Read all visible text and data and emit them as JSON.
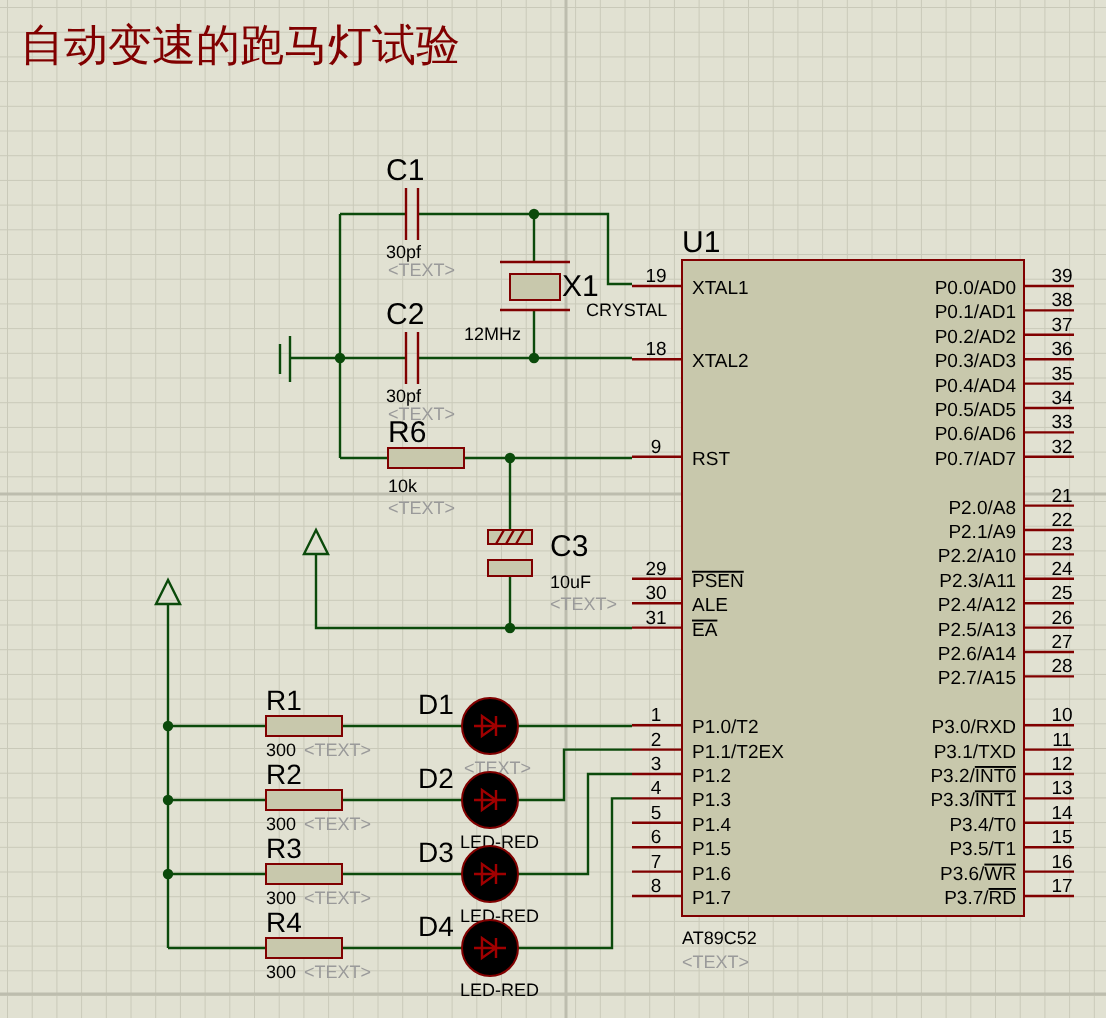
{
  "title": "自动变速的跑马灯试验",
  "chip": {
    "ref": "U1",
    "part": "AT89C52",
    "text": "<TEXT>",
    "left_pins": [
      {
        "number": "19",
        "name": "XTAL1"
      },
      {
        "number": "18",
        "name": "XTAL2"
      },
      {
        "number": "9",
        "name": "RST"
      },
      {
        "number": "29",
        "overbar_name": "PSEN"
      },
      {
        "number": "30",
        "name": "ALE"
      },
      {
        "number": "31",
        "overbar_name": "EA"
      },
      {
        "number": "1",
        "name": "P1.0/T2"
      },
      {
        "number": "2",
        "name": "P1.1/T2EX"
      },
      {
        "number": "3",
        "name": "P1.2"
      },
      {
        "number": "4",
        "name": "P1.3"
      },
      {
        "number": "5",
        "name": "P1.4"
      },
      {
        "number": "6",
        "name": "P1.5"
      },
      {
        "number": "7",
        "name": "P1.6"
      },
      {
        "number": "8",
        "name": "P1.7"
      }
    ],
    "right_pins": [
      {
        "number": "39",
        "name": "P0.0/AD0"
      },
      {
        "number": "38",
        "name": "P0.1/AD1"
      },
      {
        "number": "37",
        "name": "P0.2/AD2"
      },
      {
        "number": "36",
        "name": "P0.3/AD3"
      },
      {
        "number": "35",
        "name": "P0.4/AD4"
      },
      {
        "number": "34",
        "name": "P0.5/AD5"
      },
      {
        "number": "33",
        "name": "P0.6/AD6"
      },
      {
        "number": "32",
        "name": "P0.7/AD7"
      },
      {
        "number": "21",
        "name": "P2.0/A8"
      },
      {
        "number": "22",
        "name": "P2.1/A9"
      },
      {
        "number": "23",
        "name": "P2.2/A10"
      },
      {
        "number": "24",
        "name": "P2.3/A11"
      },
      {
        "number": "25",
        "name": "P2.4/A12"
      },
      {
        "number": "26",
        "name": "P2.5/A13"
      },
      {
        "number": "27",
        "name": "P2.6/A14"
      },
      {
        "number": "28",
        "name": "P2.7/A15"
      },
      {
        "number": "10",
        "name": "P3.0/RXD"
      },
      {
        "number": "11",
        "name": "P3.1/TXD"
      },
      {
        "number": "12",
        "name": "P3.2/",
        "overbar_name": "INT0"
      },
      {
        "number": "13",
        "name": "P3.3/",
        "overbar_name": "INT1"
      },
      {
        "number": "14",
        "name": "P3.4/T0"
      },
      {
        "number": "15",
        "name": "P3.5/T1"
      },
      {
        "number": "16",
        "name": "P3.6/",
        "overbar_name": "WR"
      },
      {
        "number": "17",
        "name": "P3.7/",
        "overbar_name": "RD"
      }
    ]
  },
  "components": [
    {
      "kind": "capacitor",
      "ref": "C1",
      "value": "30pf",
      "text": "<TEXT>"
    },
    {
      "kind": "crystal",
      "ref": "X1",
      "part": "CRYSTAL",
      "value": "12MHz"
    },
    {
      "kind": "capacitor",
      "ref": "C2",
      "value": "30pf",
      "text": "<TEXT>"
    },
    {
      "kind": "resistor",
      "ref": "R6",
      "value": "10k",
      "text": "<TEXT>"
    },
    {
      "kind": "electrolytic",
      "ref": "C3",
      "value": "10uF",
      "text": "<TEXT>"
    }
  ],
  "led_rows": [
    {
      "resistor": {
        "ref": "R1",
        "value": "300",
        "text": "<TEXT>"
      },
      "led": {
        "ref": "D1",
        "text": "<TEXT>"
      }
    },
    {
      "resistor": {
        "ref": "R2",
        "value": "300",
        "text": "<TEXT>"
      },
      "led": {
        "ref": "D2",
        "part": "LED-RED"
      }
    },
    {
      "resistor": {
        "ref": "R3",
        "value": "300",
        "text": "<TEXT>"
      },
      "led": {
        "ref": "D3",
        "part": "LED-RED"
      }
    },
    {
      "resistor": {
        "ref": "R4",
        "value": "300",
        "text": "<TEXT>"
      },
      "led": {
        "ref": "D4",
        "part": "LED-RED"
      }
    }
  ]
}
